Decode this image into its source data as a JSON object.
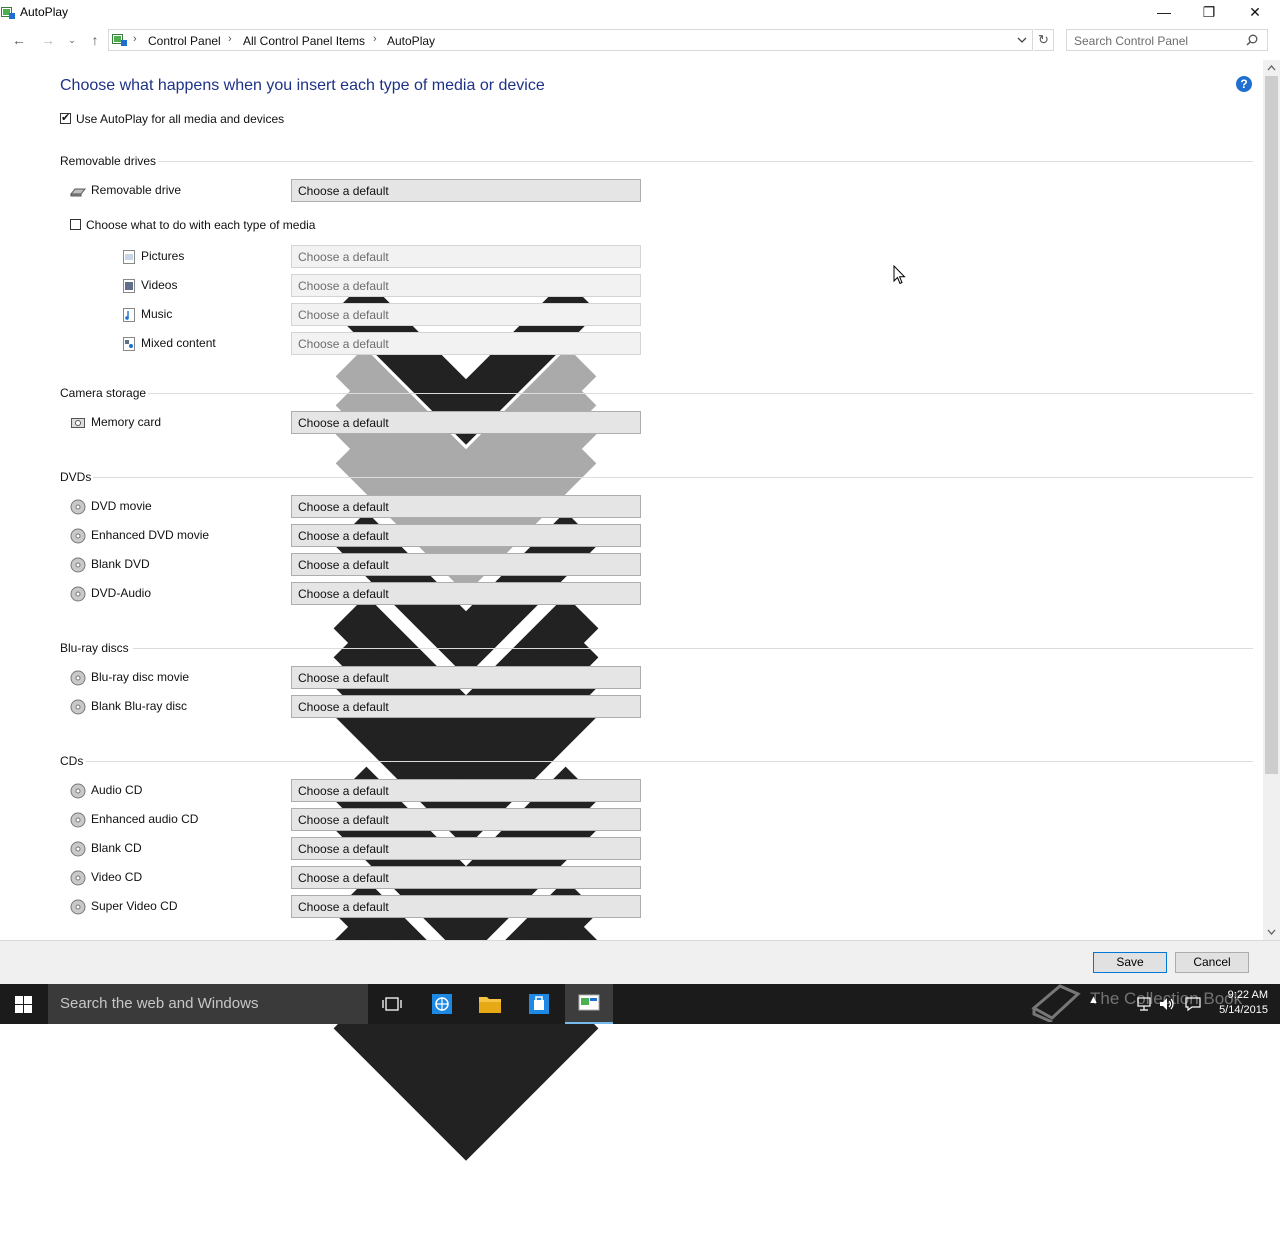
{
  "window": {
    "title": "AutoPlay"
  },
  "address": {
    "breadcrumbs": [
      "Control Panel",
      "All Control Panel Items",
      "AutoPlay"
    ],
    "search_placeholder": "Search Control Panel"
  },
  "content": {
    "heading": "Choose what happens when you insert each type of media or device",
    "use_autoplay_label": "Use AutoPlay for all media and devices",
    "use_autoplay_checked": true,
    "help_symbol": "?",
    "sections": {
      "removable": {
        "title": "Removable drives",
        "items": [
          {
            "label": "Removable drive",
            "value": "Choose a default",
            "icon": "removable-drive-icon"
          }
        ],
        "each_type_label": "Choose what to do with each type of media",
        "each_type_checked": false,
        "media_items": [
          {
            "label": "Pictures",
            "value": "Choose a default",
            "icon": "pictures-icon"
          },
          {
            "label": "Videos",
            "value": "Choose a default",
            "icon": "videos-icon"
          },
          {
            "label": "Music",
            "value": "Choose a default",
            "icon": "music-icon"
          },
          {
            "label": "Mixed content",
            "value": "Choose a default",
            "icon": "mixed-content-icon"
          }
        ]
      },
      "camera": {
        "title": "Camera storage",
        "items": [
          {
            "label": "Memory card",
            "value": "Choose a default",
            "icon": "memory-card-icon"
          }
        ]
      },
      "dvds": {
        "title": "DVDs",
        "items": [
          {
            "label": "DVD movie",
            "value": "Choose a default",
            "icon": "disc-icon"
          },
          {
            "label": "Enhanced DVD movie",
            "value": "Choose a default",
            "icon": "disc-icon"
          },
          {
            "label": "Blank DVD",
            "value": "Choose a default",
            "icon": "disc-icon"
          },
          {
            "label": "DVD-Audio",
            "value": "Choose a default",
            "icon": "disc-icon"
          }
        ]
      },
      "bluray": {
        "title": "Blu-ray discs",
        "items": [
          {
            "label": "Blu-ray disc movie",
            "value": "Choose a default",
            "icon": "disc-icon"
          },
          {
            "label": "Blank Blu-ray disc",
            "value": "Choose a default",
            "icon": "disc-icon"
          }
        ]
      },
      "cds": {
        "title": "CDs",
        "items": [
          {
            "label": "Audio CD",
            "value": "Choose a default",
            "icon": "disc-icon"
          },
          {
            "label": "Enhanced audio CD",
            "value": "Choose a default",
            "icon": "disc-icon"
          },
          {
            "label": "Blank CD",
            "value": "Choose a default",
            "icon": "disc-icon"
          },
          {
            "label": "Video CD",
            "value": "Choose a default",
            "icon": "disc-icon"
          },
          {
            "label": "Super Video CD",
            "value": "Choose a default",
            "icon": "disc-icon"
          }
        ]
      }
    }
  },
  "footer": {
    "save_label": "Save",
    "cancel_label": "Cancel"
  },
  "taskbar": {
    "search_placeholder": "Search the web and Windows",
    "time": "9:22 AM",
    "date": "5/14/2015",
    "watermark": "The Collection Book"
  },
  "colors": {
    "heading": "#1e3287",
    "accent": "#0078d7",
    "taskbar": "#1b1b1b"
  }
}
